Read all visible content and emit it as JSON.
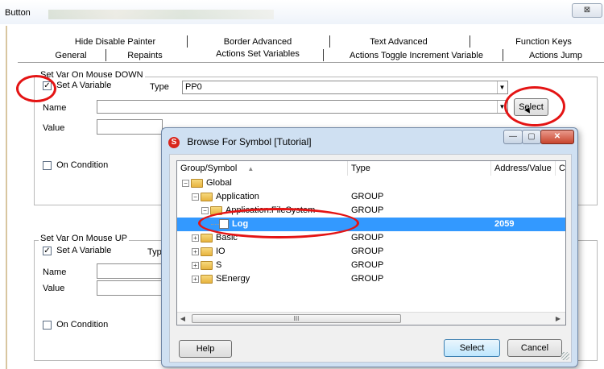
{
  "window": {
    "title": "Button",
    "close_glyph": "⊠"
  },
  "tabs_row1": [
    "Hide Disable Painter",
    "Border Advanced",
    "Text Advanced",
    "Function Keys"
  ],
  "tabs_row2": [
    "General",
    "Repaints",
    "Actions Set Variables",
    "Actions Toggle Increment Variable",
    "Actions Jump"
  ],
  "mouse_down": {
    "legend": "Set Var On Mouse DOWN",
    "set_variable_label": "Set A Variable",
    "set_variable_checked": true,
    "type_label": "Type",
    "type_value": "PP0",
    "name_label": "Name",
    "name_value": "",
    "value_label": "Value",
    "value_value": "",
    "on_condition_label": "On Condition",
    "select_button": "Select"
  },
  "mouse_up": {
    "legend": "Set Var On Mouse UP",
    "set_variable_label": "Set A Variable",
    "set_variable_checked": true,
    "type_label": "Typ",
    "name_label": "Name",
    "value_label": "Value",
    "on_condition_label": "On Condition"
  },
  "dialog": {
    "title": "Browse For Symbol [Tutorial]",
    "logo_letter": "S",
    "columns": [
      "Group/Symbol",
      "Type",
      "Address/Value",
      "C"
    ],
    "sort_glyph": "▲",
    "rows": [
      {
        "label": "Global",
        "type": "",
        "address": "",
        "indent": 0,
        "expander": "−",
        "icon": "folder",
        "selected": false
      },
      {
        "label": "Application",
        "type": "GROUP",
        "address": "",
        "indent": 1,
        "expander": "−",
        "icon": "folder",
        "selected": false
      },
      {
        "label": "Application.FileSystem",
        "type": "GROUP",
        "address": "",
        "indent": 2,
        "expander": "−",
        "icon": "folder",
        "selected": false
      },
      {
        "label": "Log",
        "type": "",
        "address": "2059",
        "indent": 3,
        "expander": "",
        "icon": "file",
        "selected": true
      },
      {
        "label": "Basic",
        "type": "GROUP",
        "address": "",
        "indent": 1,
        "expander": "+",
        "icon": "folder",
        "selected": false
      },
      {
        "label": "IO",
        "type": "GROUP",
        "address": "",
        "indent": 1,
        "expander": "+",
        "icon": "folder",
        "selected": false
      },
      {
        "label": "S",
        "type": "GROUP",
        "address": "",
        "indent": 1,
        "expander": "+",
        "icon": "folder",
        "selected": false
      },
      {
        "label": "SEnergy",
        "type": "GROUP",
        "address": "",
        "indent": 1,
        "expander": "+",
        "icon": "folder",
        "selected": false
      }
    ],
    "scroll_thumb_glyph": "III",
    "help_button": "Help",
    "select_button": "Select",
    "cancel_button": "Cancel"
  },
  "colors": {
    "annotation": "#e41414",
    "selection": "#3399ff"
  }
}
